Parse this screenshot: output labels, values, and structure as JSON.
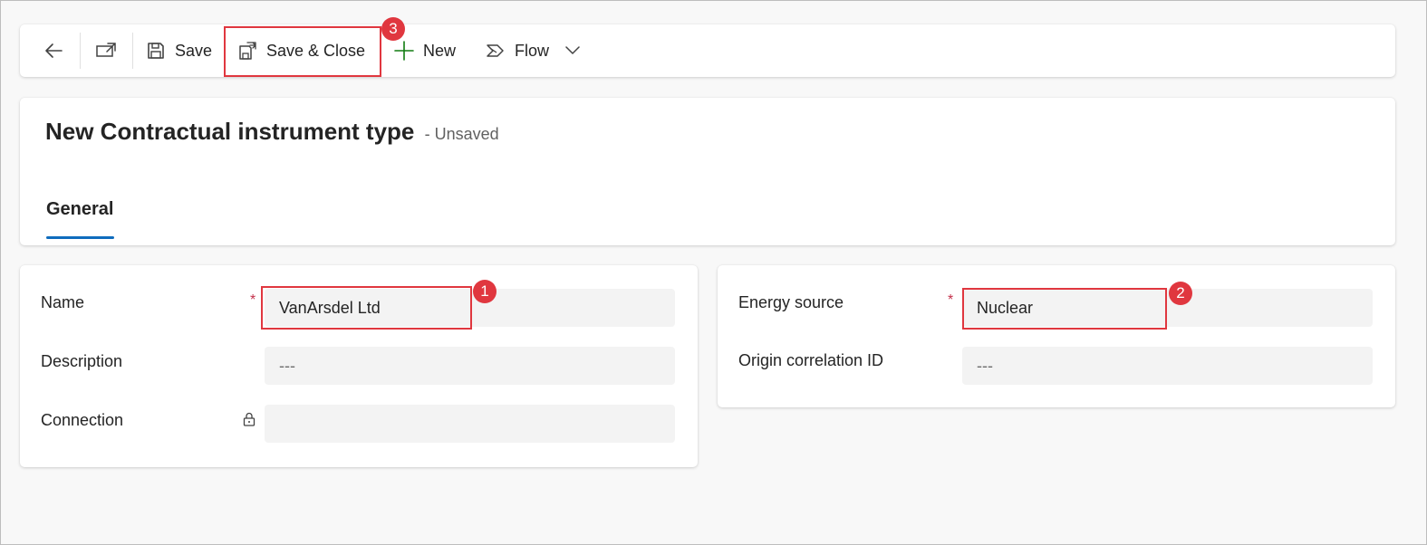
{
  "command_bar": {
    "back_icon": "arrow-left-icon",
    "open_in_new_window_icon": "open-in-new-window-icon",
    "save_label": "Save",
    "save_close_label": "Save & Close",
    "new_label": "New",
    "flow_label": "Flow"
  },
  "header": {
    "title": "New Contractual instrument type",
    "status": "- Unsaved",
    "tabs": [
      {
        "label": "General",
        "selected": true
      }
    ]
  },
  "section_left": {
    "fields": [
      {
        "label": "Name",
        "value": "VanArsdel Ltd",
        "required": true
      },
      {
        "label": "Description",
        "value": "---"
      },
      {
        "label": "Connection",
        "value": "",
        "locked": true
      }
    ]
  },
  "section_right": {
    "fields": [
      {
        "label": "Energy source",
        "value": "Nuclear",
        "required": true
      },
      {
        "label": "Origin correlation ID",
        "value": "---"
      }
    ]
  },
  "callouts": {
    "name": "1",
    "energy_source": "2",
    "save_close": "3"
  },
  "colors": {
    "highlight": "#e0373f",
    "accent": "#0f6cbd",
    "required": "#c4314b",
    "new_icon": "#107c10"
  },
  "required_marker": "*"
}
